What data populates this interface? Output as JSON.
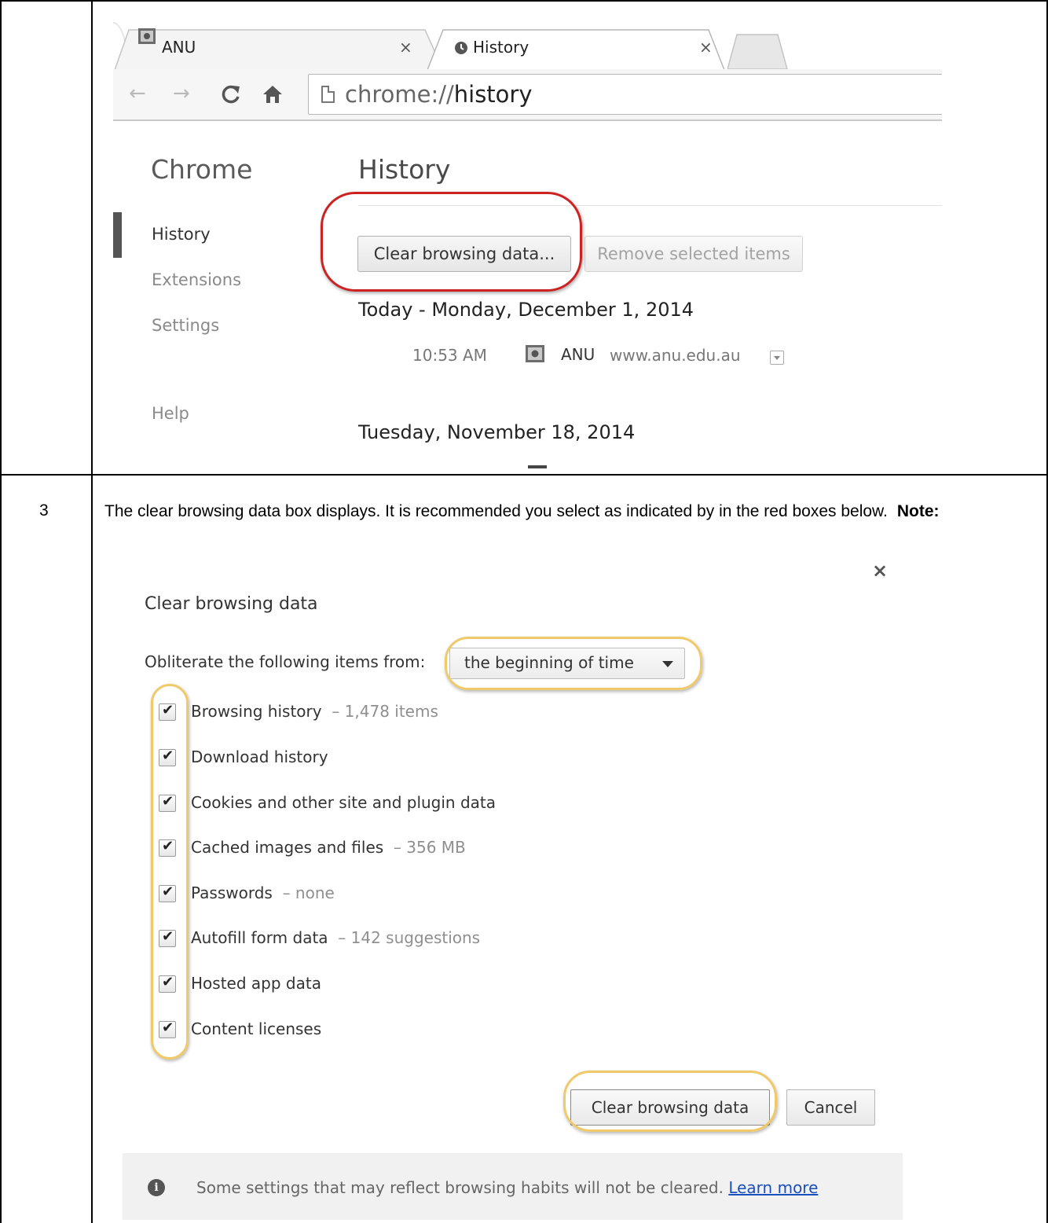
{
  "step_number": "3",
  "instruction": {
    "text": "The clear browsing data box displays. It is recommended you select as indicated by in the red boxes below.",
    "note": "Note:"
  },
  "browser": {
    "tabs": [
      {
        "title": "ANU",
        "icon": "anu-crest-icon",
        "close": "×"
      },
      {
        "title": "History",
        "icon": "clock-icon",
        "close": "×"
      }
    ],
    "nav_icons": [
      "back-arrow-icon",
      "forward-arrow-icon",
      "reload-icon",
      "home-icon"
    ],
    "url_scheme": "chrome://",
    "url_host": "history"
  },
  "history_page": {
    "sidebar": {
      "title": "Chrome",
      "items": [
        "History",
        "Extensions",
        "Settings",
        "Help"
      ]
    },
    "title": "History",
    "clear_button": "Clear browsing data...",
    "remove_button": "Remove selected items",
    "days": [
      {
        "label": "Today - Monday, December 1, 2014",
        "entries": [
          {
            "time": "10:53 AM",
            "title": "ANU",
            "url": "www.anu.edu.au"
          }
        ]
      },
      {
        "label": "Tuesday, November 18, 2014",
        "entries": []
      }
    ]
  },
  "dialog": {
    "close": "×",
    "title": "Clear browsing data",
    "obliterate_label": "Obliterate the following items from:",
    "time_range": "the beginning of time",
    "items": [
      {
        "label": "Browsing history",
        "detail": "– 1,478 items",
        "checked": true
      },
      {
        "label": "Download history",
        "detail": "",
        "checked": true
      },
      {
        "label": "Cookies and other site and plugin data",
        "detail": "",
        "checked": true
      },
      {
        "label": "Cached images and files",
        "detail": "– 356 MB",
        "checked": true
      },
      {
        "label": "Passwords",
        "detail": "– none",
        "checked": true
      },
      {
        "label": "Autofill form data",
        "detail": "– 142 suggestions",
        "checked": true
      },
      {
        "label": "Hosted app data",
        "detail": "",
        "checked": true
      },
      {
        "label": "Content licenses",
        "detail": "",
        "checked": true
      }
    ],
    "clear_button": "Clear browsing data",
    "cancel_button": "Cancel",
    "footer_text": "Some settings that may reflect browsing habits will not be cleared.",
    "footer_link": "Learn more",
    "check_glyph": "✔"
  },
  "colors": {
    "highlight_red": "#cc2222",
    "highlight_yellow": "#f0c96a",
    "link_blue": "#1a4fbf"
  }
}
